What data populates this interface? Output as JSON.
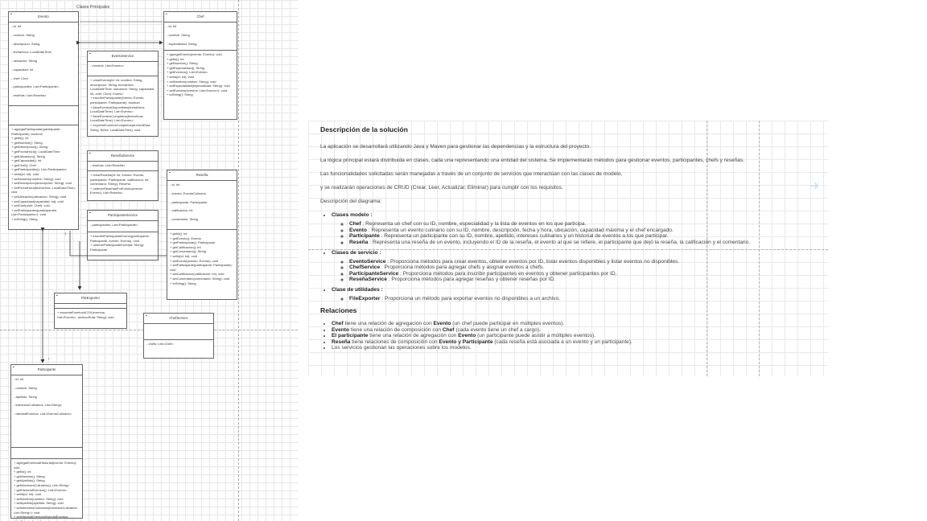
{
  "diagram": {
    "title": "Clases Principales",
    "classes": {
      "evento": {
        "name": "Evento",
        "attributes": [
          "- id: int",
          "- nombre: String",
          "- descripcion: String",
          "- fechaHora: LocalDateTime",
          "- ubicacion: String",
          "- capacidad: int",
          "- chef: Chef",
          "- participantes: List<Participante>",
          "- reseñas: List<Reseña>"
        ],
        "methods": [
          "+ agregarParticipante(participante: Participante): boolean",
          "+ getId(): int",
          "+ getNombre(): String",
          "+ getDescripcion(): String",
          "+ getFechaHora(): LocalDateTime",
          "+ getUbicacion(): String",
          "+ getCapacidad(): int",
          "+ getChef(): Chef",
          "+ getParticipantes(): List<Participante>",
          "+ setId(id: int): void",
          "+ setNombre(nombre: String): void",
          "+ setDescripcion(descripcion: String): void",
          "+ setFechaHora(fechaHora: LocalDateTime): void",
          "+ setUbicacion(ubicacion: String): void",
          "+ setCapacidad(capacidad: int): void",
          "+ setChef(chef: Chef): void",
          "+ setParticipantes(participantes: List<Participante>): void",
          "+ toString(): String"
        ]
      },
      "chef": {
        "name": "Chef",
        "attributes": [
          "- id: int",
          "- nombre: String",
          "- especialidad: String",
          "- eventos: List<Evento>"
        ],
        "methods": [
          "+ agregarEvento(evento: Evento): void",
          "+ getId(): int",
          "+ getNombre(): String",
          "+ getEspecialidad(): String",
          "+ getEventos(): List<Evento>",
          "+ setId(id: int): void",
          "+ setNombre(nombre: String): void",
          "+ setEspecialidad(especialidad: String): void",
          "+ setEventos(eventos: List<Evento>): void",
          "+ toString(): String"
        ]
      },
      "eventoService": {
        "name": "EventoService",
        "attributes": [
          "- eventos: List<Evento>"
        ],
        "methods": [
          "+ crearEvento(id: int, nombre: String, descripcion: String, fechaHora: LocalDateTime, ubicacion: String, capacidad: int, chef: Chef): Evento",
          "+ inscribirParticipante(evento: Evento, participante: Participante): boolean",
          "+ listarEventosDisponibles(fechaHora: LocalDateTime): List<Evento>",
          "+ listarEventosCompletos(fechaHora: LocalDateTime): List<Evento>",
          "+ exportarEventosCompletos(archivoRuta: String, fecha: LocalDateTime): void"
        ]
      },
      "reseñaService": {
        "name": "ReseñaService",
        "attributes": [
          "- reseñas: List<Reseña>"
        ],
        "methods": [
          "+ crearReseña(id: int, evento: Evento, participante: Participante, calificacion: int, comentario: String): Reseña",
          "+ obtenerReseñasPorEvento(evento: Evento): List<Reseña>"
        ]
      },
      "participanteService": {
        "name": "ParticipanteService",
        "attributes": [
          "- participantes: List<Participante>"
        ],
        "methods": [
          "+ inscribirParticipanteEvento(participante: Participante, evento: Evento): void",
          "+ obtenerParticipantePorId(id: String): Participante"
        ]
      },
      "reseña": {
        "name": "Reseña",
        "attributes": [
          "- id: int",
          "- evento: EventoCulinario",
          "- participante: Participante",
          "- calificacion: int",
          "- comentario: String"
        ],
        "methods": [
          "+ getId(): int",
          "+ getEvento(): Evento",
          "+ getParticipante(): Participante",
          "+ getCalificacion(): int",
          "+ getComentario(): String",
          "+ setId(id: int): void",
          "+ setEvento(evento: Evento): void",
          "+ setParticipante(participante: Participante): void",
          "+ setCalificacion(calificacion: int): void",
          "+ setComentario(comentario: String): void",
          "+ toString(): String"
        ]
      },
      "fileExporter": {
        "name": "FileExporter",
        "attributes": [],
        "methods": [
          "+ exportarEventosACSV(eventos: List<Evento>, archivoRuta: String): void"
        ]
      },
      "chefService": {
        "name": "ChefService",
        "attributes": [
          "- chefs: List<Chef>"
        ],
        "methods": []
      },
      "participante": {
        "name": "Participante",
        "attributes": [
          "- id: int",
          "- nombre: String",
          "- apellido: String",
          "- interesesCulinarios: List<String>",
          "- historialEventos: List<EventoCulinario>"
        ],
        "methods": [
          "+ agregarEventoAlHistorial(evento: Evento): void",
          "+ getId(): int",
          "+ getNombre(): String",
          "+ getApellido(): String",
          "+ getInteresesCulinarios(): List<String>",
          "+ getHistorialEventos(): List<Evento>",
          "+ setId(id: int): void",
          "+ setNombre(nombre: String): void",
          "+ setApellido(apellido: String): void",
          "+ setInteresesCulinarios(interesesCulinarios: List<String>): void",
          "+ setHistorialEventos(historialEventos: List<Evento>): void",
          "+ toString(): String"
        ]
      }
    }
  },
  "panel": {
    "title": "Descripción de la solución",
    "paragraphs": [
      "La aplicación se desarrollará utilizando Java y Maven para gestionar las dependencias y la estructura del proyecto.",
      "La lógica principal estará distribuida en clases, cada una representando una entidad del sistema. Se implementarán métodos para gestionar eventos, participantes, chefs y reseñas.",
      "Las funcionalidades solicitadas serán manejadas a través de un conjunto de servicios que interactúan con las clases de modelo,",
      "y se realizarán operaciones de CRUD (Crear, Leer, Actualizar, Eliminar) para cumplir con los requisitos.",
      "Descripción del diagrama:"
    ],
    "groups": [
      {
        "heading": "Clases modelo :",
        "items": [
          {
            "name": "Chef",
            "text": " : Representa un chef con su ID, nombre, especialidad y la lista de eventos en los que participa."
          },
          {
            "name": "Evento",
            "text": " : Representa un evento culinario con su ID, nombre, descripción, fecha y hora, ubicación, capacidad máxima y el chef encargado."
          },
          {
            "name": "Participante",
            "text": " : Representa un participante con su ID, nombre, apellido, intereses culinarios y un historial de eventos a los que participar."
          },
          {
            "name": "Reseña",
            "text": " : Representa una reseña de un evento, incluyendo el ID de la reseña, el evento al que se refiere, el participante que dejó la reseña, la calificación y el comentario."
          }
        ]
      },
      {
        "heading": "Clases de servicio :",
        "items": [
          {
            "name": "EventoService",
            "text": " : Proporciona métodos para crear eventos, obtener eventos por ID, listar eventos disponibles y listar eventos no disponibles."
          },
          {
            "name": "ChefService",
            "text": " : Proporciona métodos para agregar chefs y asignar eventos a chefs."
          },
          {
            "name": "ParticipanteService",
            "text": " : Proporciona métodos para inscribir participantes en eventos y obtener participantes por ID."
          },
          {
            "name": "ReseñaService",
            "text": " : Proporciona métodos para agregar reseñas y obtener reseñas por ID."
          }
        ]
      },
      {
        "heading": "Clase de utilidades :",
        "items": [
          {
            "name": "FileExporter",
            "text": " : Proporciona un método para exportar eventos no disponibles a un archivo."
          }
        ]
      }
    ],
    "relations_title": "Relaciones",
    "relations": [
      {
        "p1": "",
        "b1": "Chef",
        "p2": " tiene una relación de agregación con ",
        "b2": "Evento",
        "p3": " (un chef puede participar en múltiples eventos)."
      },
      {
        "p1": "",
        "b1": "Evento",
        "p2": " tiene una relación de composición con ",
        "b2": "Chef",
        "p3": " (cada evento tiene un chef a cargo)."
      },
      {
        "p1": "",
        "b1": "El participante",
        "p2": " tiene una relación de agregación con ",
        "b2": "Evento",
        "p3": " (un participante puede asistir a múltiples eventos)."
      },
      {
        "p1": "",
        "b1": "Reseña",
        "p2": " tiene relaciones de composición con ",
        "b2": "Evento y Participante",
        "p3": " (cada reseña está asociada a un evento y un participante)."
      },
      {
        "p1": "Los servicios gestionan las operaciones sobre los modelos.",
        "b1": "",
        "p2": "",
        "b2": "",
        "p3": ""
      }
    ]
  },
  "colors": {
    "grid": "#e6e6e6",
    "border": "#666666",
    "arrow": "#333333",
    "side_arrow": "#cfe3f3"
  },
  "icons": [
    "arrow-right-icon"
  ]
}
